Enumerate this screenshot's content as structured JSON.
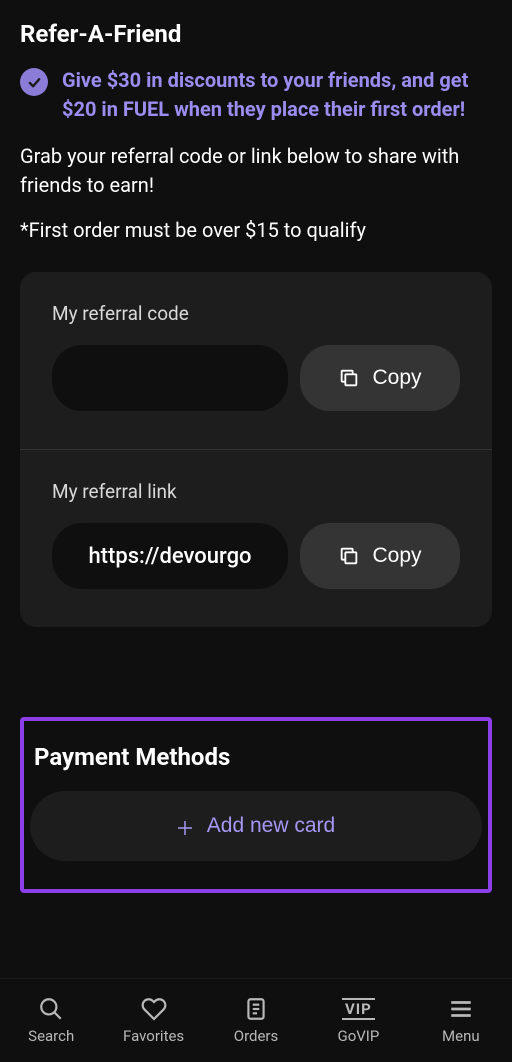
{
  "referral": {
    "title": "Refer-A-Friend",
    "promo": "Give $30 in discounts to your friends, and get $20 in FUEL when they place their first order!",
    "description": "Grab your referral code or link below to share with friends to earn!",
    "qualifier": "*First order must be over $15 to qualify",
    "code_label": "My referral code",
    "code_value": "",
    "link_label": "My referral link",
    "link_value": "https://devourgo",
    "copy_label": "Copy"
  },
  "payment": {
    "title": "Payment Methods",
    "add_card_label": "Add new card"
  },
  "nav": {
    "search": "Search",
    "favorites": "Favorites",
    "orders": "Orders",
    "govip": "GoVIP",
    "menu": "Menu"
  }
}
